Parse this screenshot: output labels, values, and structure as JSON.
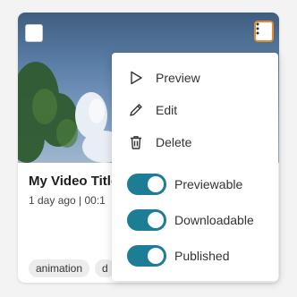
{
  "video": {
    "title": "My Video Title",
    "subtitle": "1 day ago  |  00:1",
    "tags": [
      "animation",
      "d"
    ]
  },
  "menu": {
    "actions": [
      {
        "label": "Preview",
        "icon": "play-icon"
      },
      {
        "label": "Edit",
        "icon": "pencil-icon"
      },
      {
        "label": "Delete",
        "icon": "trash-icon"
      }
    ],
    "toggles": [
      {
        "label": "Previewable",
        "on": true
      },
      {
        "label": "Downloadable",
        "on": true
      },
      {
        "label": "Published",
        "on": true
      }
    ]
  },
  "colors": {
    "toggle_on": "#1d7d95",
    "kebab_border": "#e38a2f"
  }
}
